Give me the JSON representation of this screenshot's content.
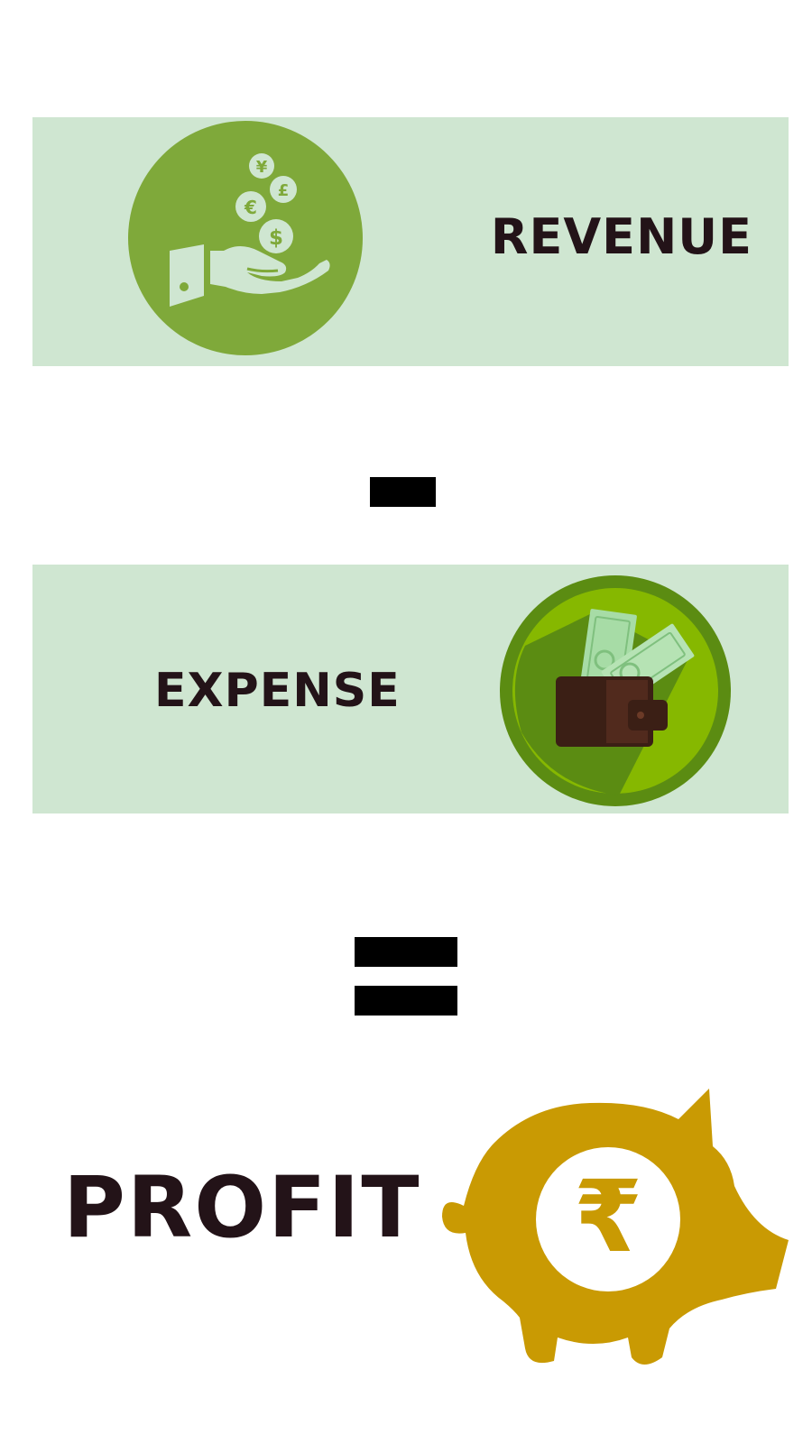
{
  "equation": {
    "revenue": {
      "label": "REVENUE",
      "icon": "hand-receiving-coins-icon"
    },
    "operator_minus": {
      "icon": "minus-sign"
    },
    "expense": {
      "label": "EXPENSE",
      "icon": "wallet-with-banknotes-icon"
    },
    "operator_equals": {
      "icon": "equals-sign"
    },
    "profit": {
      "label": "PROFIT",
      "icon": "piggy-bank-rupee-icon"
    }
  },
  "colors": {
    "panel_background": "#cfe6d1",
    "revenue_icon_green": "#7fa93a",
    "expense_icon_green": "#5b8c12",
    "expense_icon_lime": "#86b800",
    "wallet_brown": "#4a2519",
    "piggy_bank_gold": "#c99a03",
    "text": "#231318",
    "operator": "#000000"
  },
  "coins": {
    "yen": "¥",
    "pound": "£",
    "euro": "€",
    "dollar": "$"
  },
  "rupee_symbol": "₹"
}
